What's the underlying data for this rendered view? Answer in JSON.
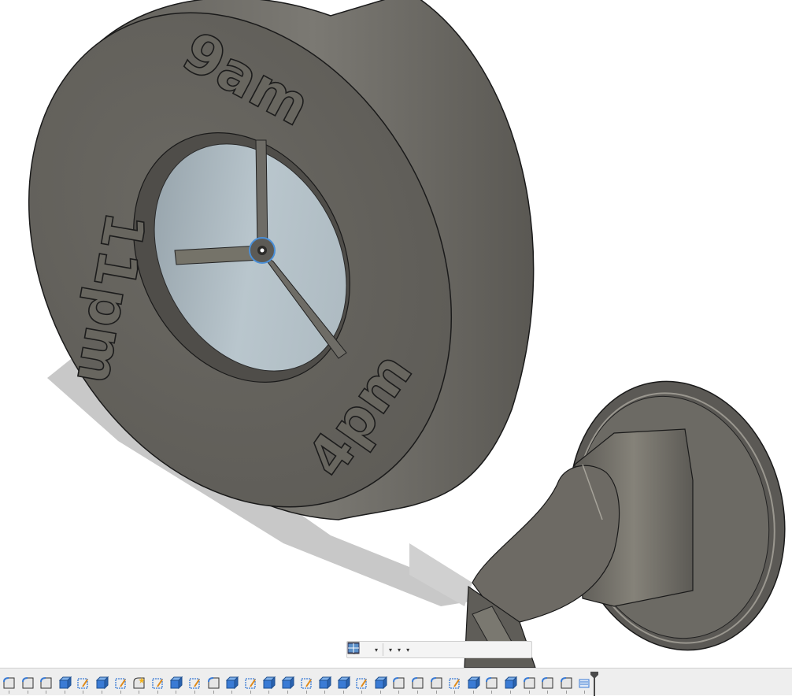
{
  "app": {
    "name": "Fusion 360 viewport",
    "accent_color": "#4a8fd8"
  },
  "model": {
    "dial_labels": {
      "top": "9am",
      "left": "11pm",
      "right": "4pm"
    },
    "body_color": "#6e6c66",
    "face_color": "#b4c3cb"
  },
  "navigation_bar": {
    "tools": [
      {
        "icon": "orbit-icon",
        "has_dropdown": true
      },
      {
        "icon": "look-at-icon",
        "has_dropdown": false
      },
      {
        "icon": "pan-hand-icon",
        "has_dropdown": false
      },
      {
        "icon": "zoom-icon",
        "has_dropdown": false
      },
      {
        "icon": "fit-window-icon",
        "has_dropdown": true
      },
      {
        "icon": "display-settings-icon",
        "has_dropdown": true
      },
      {
        "icon": "grid-snaps-icon",
        "has_dropdown": true
      },
      {
        "icon": "viewports-icon",
        "has_dropdown": true
      }
    ]
  },
  "timeline": {
    "features": [
      "fillet",
      "fillet",
      "fillet",
      "extrude",
      "sketch",
      "extrude",
      "sketch",
      "fillet-star",
      "sketch",
      "extrude",
      "sketch",
      "fillet",
      "extrude",
      "sketch",
      "extrude",
      "extrude",
      "sketch",
      "extrude",
      "extrude",
      "sketch",
      "extrude",
      "fillet",
      "fillet",
      "fillet",
      "sketch",
      "extrude",
      "fillet",
      "extrude",
      "fillet",
      "fillet",
      "fillet",
      "sketch-stack"
    ]
  }
}
